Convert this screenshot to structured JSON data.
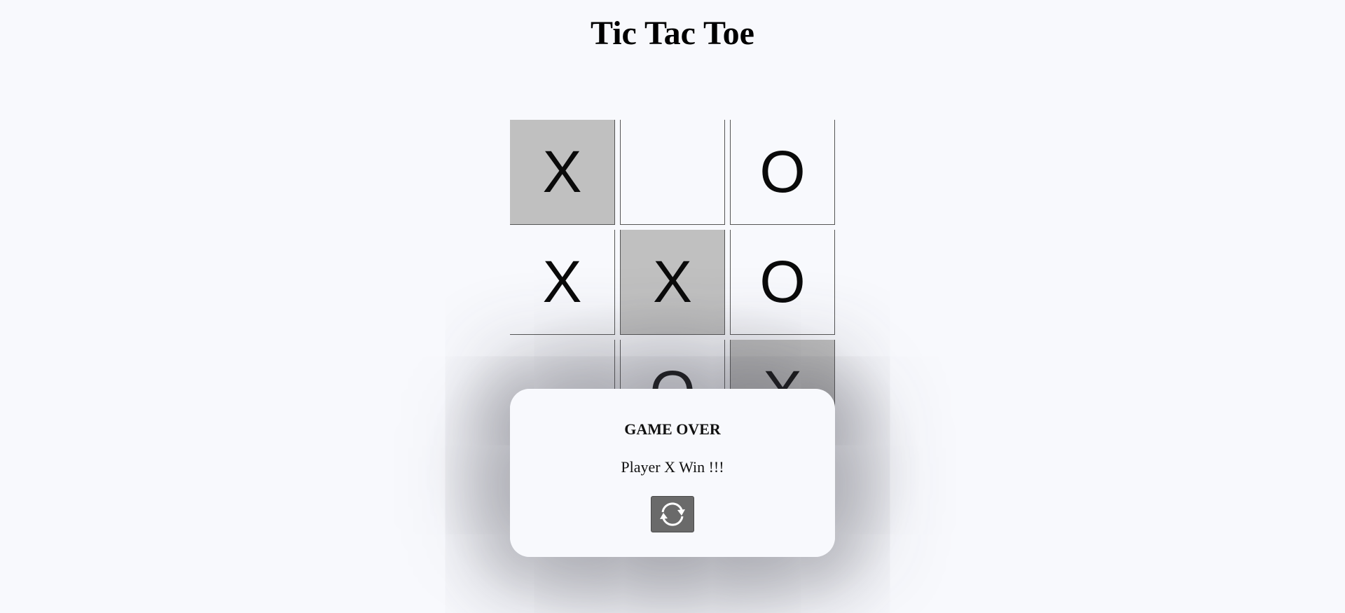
{
  "title": "Tic Tac Toe",
  "board": {
    "cells": [
      "X",
      "",
      "O",
      "X",
      "X",
      "O",
      "",
      "O",
      "X"
    ],
    "winning_cells": [
      0,
      4,
      8
    ],
    "highlight_color": "#c0c0c0"
  },
  "modal": {
    "heading": "GAME OVER",
    "message": "Player X Win !!!",
    "restart_icon": "refresh-icon"
  },
  "colors": {
    "background": "#f8f9fd",
    "button": "#6a6a6a"
  }
}
